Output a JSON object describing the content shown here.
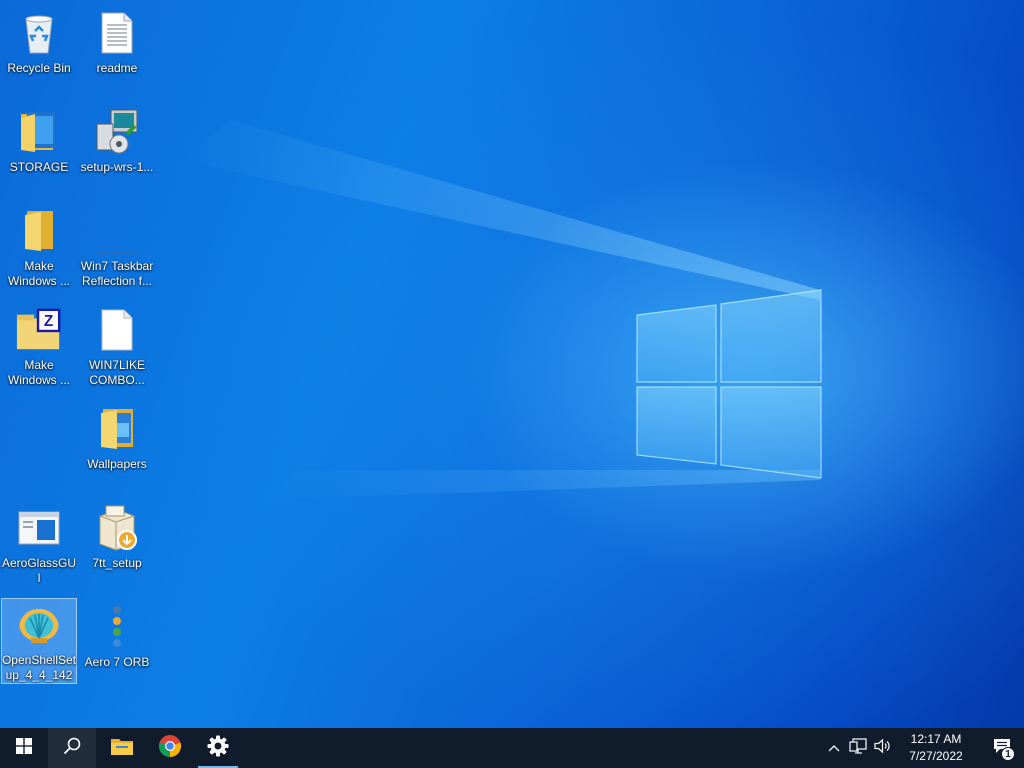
{
  "desktop": {
    "icons": [
      {
        "label": "Recycle Bin",
        "icon": "recycle-bin-icon"
      },
      {
        "label": "readme",
        "icon": "text-document-icon"
      },
      {
        "label": "STORAGE",
        "icon": "folder-icon"
      },
      {
        "label": "setup-wrs-1...",
        "icon": "installer-icon"
      },
      {
        "label": "Make\nWindows ...",
        "icon": "folder-icon"
      },
      {
        "label": "Win7 Taskbar\nReflection f...",
        "icon": "blank-shortcut-icon"
      },
      {
        "label": "Make\nWindows ...",
        "icon": "zip-folder-icon"
      },
      {
        "label": "WIN7LIKE\nCOMBO...",
        "icon": "blank-document-icon"
      },
      {
        "label": "Wallpapers",
        "icon": "folder-icon"
      },
      {
        "label": "AeroGlassGUI",
        "icon": "window-app-icon"
      },
      {
        "label": "7tt_setup",
        "icon": "setup-box-icon"
      },
      {
        "label": "OpenShellSet\nup_4_4_142",
        "icon": "shell-icon",
        "selected": true
      },
      {
        "label": "Aero 7 ORB",
        "icon": "orb-icon"
      }
    ]
  },
  "taskbar": {
    "start": "windows-start-icon",
    "search": "search-icon",
    "pinned": [
      {
        "name": "file-explorer",
        "icon": "folder-icon"
      },
      {
        "name": "chrome",
        "icon": "chrome-icon"
      },
      {
        "name": "settings",
        "icon": "gear-icon",
        "open": true
      }
    ],
    "tray": {
      "chevron": "chevron-up-icon",
      "network": "network-icon",
      "volume": "volume-icon"
    },
    "clock": {
      "time": "12:17 AM",
      "date": "7/27/2022"
    },
    "notifications": {
      "icon": "notification-icon",
      "count": "1"
    }
  },
  "colors": {
    "taskbar": "#101c2c",
    "accent": "#76b9ed",
    "folder": "#f2c94c"
  }
}
